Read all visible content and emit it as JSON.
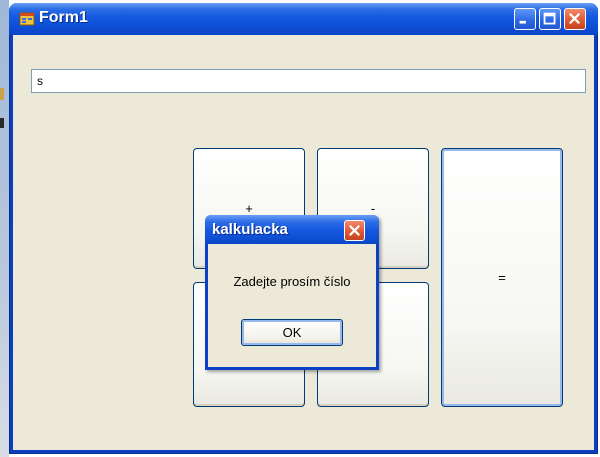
{
  "window": {
    "title": "Form1"
  },
  "input": {
    "value": "s"
  },
  "buttons": {
    "plus": "+",
    "minus": "-",
    "multiply": "",
    "divide": "",
    "equals": "="
  },
  "message_box": {
    "title": "kalkulacka",
    "text": "Zadejte prosím číslo",
    "ok_label": "OK"
  },
  "colors": {
    "titlebar": "#0f52da",
    "client_bg": "#ece9d8",
    "close_button": "#e05a33"
  }
}
